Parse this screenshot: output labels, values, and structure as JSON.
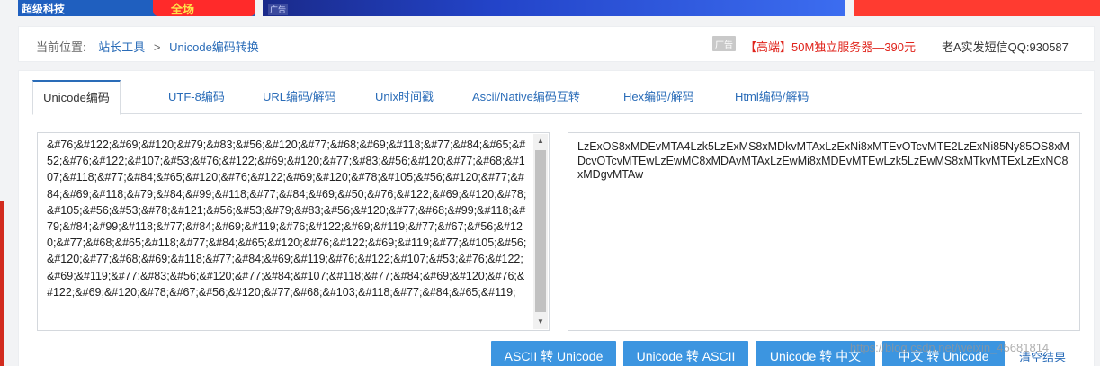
{
  "top_ads": {
    "left_brand": "超级科技",
    "left_tag": "全场",
    "center_mark": "广告"
  },
  "breadcrumb": {
    "prefix": "当前位置:",
    "items": [
      "站长工具",
      "Unicode编码转换"
    ],
    "separator": ">"
  },
  "header_ad": {
    "label": "广告",
    "text": "【高端】50M独立服务器—390元",
    "qq_text": "老A实发短信QQ:930587"
  },
  "tabs": [
    {
      "label": "Unicode编码",
      "active": true
    },
    {
      "label": "UTF-8编码",
      "active": false
    },
    {
      "label": "URL编码/解码",
      "active": false
    },
    {
      "label": "Unix时间戳",
      "active": false
    },
    {
      "label": "Ascii/Native编码互转",
      "active": false
    },
    {
      "label": "Hex编码/解码",
      "active": false
    },
    {
      "label": "Html编码/解码",
      "active": false
    }
  ],
  "input": {
    "value": "&#76;&#122;&#69;&#120;&#79;&#83;&#56;&#120;&#77;&#68;&#69;&#118;&#77;&#84;&#65;&#52;&#76;&#122;&#107;&#53;&#76;&#122;&#69;&#120;&#77;&#83;&#56;&#120;&#77;&#68;&#107;&#118;&#77;&#84;&#65;&#120;&#76;&#122;&#69;&#120;&#78;&#105;&#56;&#120;&#77;&#84;&#69;&#118;&#79;&#84;&#99;&#118;&#77;&#84;&#69;&#50;&#76;&#122;&#69;&#120;&#78;&#105;&#56;&#53;&#78;&#121;&#56;&#53;&#79;&#83;&#56;&#120;&#77;&#68;&#99;&#118;&#79;&#84;&#99;&#118;&#77;&#84;&#69;&#119;&#76;&#122;&#69;&#119;&#77;&#67;&#56;&#120;&#77;&#68;&#65;&#118;&#77;&#84;&#65;&#120;&#76;&#122;&#69;&#119;&#77;&#105;&#56;&#120;&#77;&#68;&#69;&#118;&#77;&#84;&#69;&#119;&#76;&#122;&#107;&#53;&#76;&#122;&#69;&#119;&#77;&#83;&#56;&#120;&#77;&#84;&#107;&#118;&#77;&#84;&#69;&#120;&#76;&#122;&#69;&#120;&#78;&#67;&#56;&#120;&#77;&#68;&#103;&#118;&#77;&#84;&#65;&#119;"
  },
  "output": {
    "value": "LzExOS8xMDEvMTA4Lzk5LzExMS8xMDkvMTAxLzExNi8xMTEvOTcvMTE2LzExNi85Ny85OS8xMDcvOTcvMTEwLzEwMC8xMDAvMTAxLzEwMi8xMDEvMTEwLzk5LzEwMS8xMTkvMTExLzExNC8xMDgvMTAw"
  },
  "buttons": {
    "ascii_to_unicode": "ASCII 转 Unicode",
    "unicode_to_ascii": "Unicode 转 ASCII",
    "unicode_to_chinese": "Unicode 转 中文",
    "chinese_to_unicode": "中文 转 Unicode",
    "clear": "清空结果"
  },
  "watermark": "https://blog.csdn.net/weixin_45681814",
  "colors": {
    "accent": "#2a6cb8",
    "button": "#3c95e0",
    "ad_red": "#e0241c"
  }
}
